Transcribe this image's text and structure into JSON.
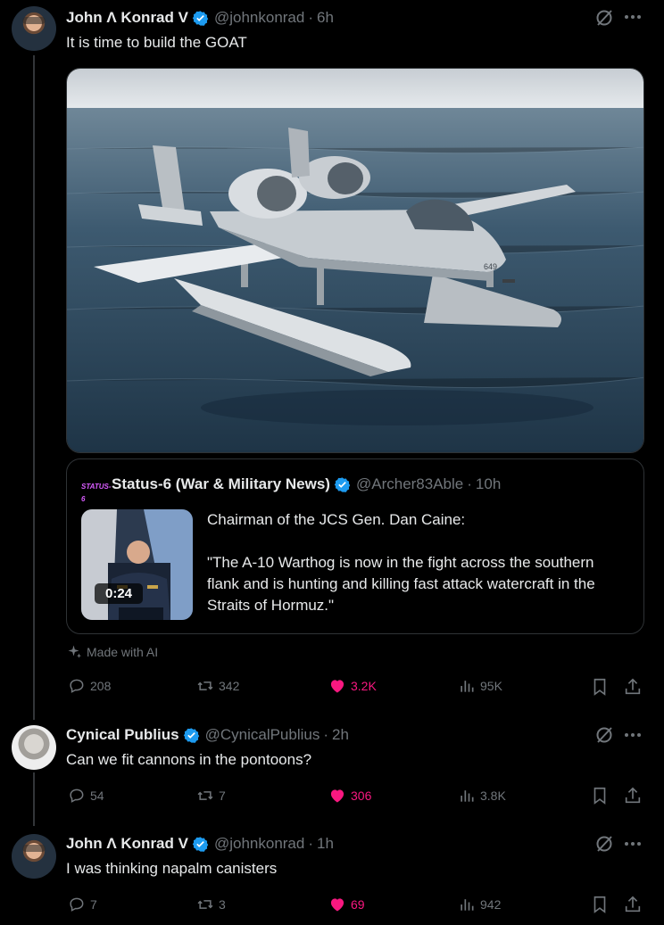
{
  "posts": [
    {
      "author": "John Λ Konrad V",
      "handle": "@johnkonrad",
      "time": "6h",
      "text": "It is time to build the GOAT",
      "media_alt": "A-10 Warthog aircraft fitted with pontoon floats on the ocean",
      "aircraft_number": "649",
      "quote": {
        "brand": "STATUS-6",
        "author": "Status-6 (War & Military News)",
        "handle": "@Archer83Able",
        "time": "10h",
        "duration": "0:24",
        "text_line1": "Chairman of the JCS Gen. Dan Caine:",
        "text_line2": "\"The A-10 Warthog is now in the fight across the southern flank and is hunting and killing fast attack watercraft in the Straits of Hormuz.\""
      },
      "made_with_ai": "Made with AI",
      "replies": "208",
      "reposts": "342",
      "likes": "3.2K",
      "views": "95K"
    },
    {
      "author": "Cynical Publius",
      "handle": "@CynicalPublius",
      "time": "2h",
      "text": "Can we fit cannons in the pontoons?",
      "replies": "54",
      "reposts": "7",
      "likes": "306",
      "views": "3.8K"
    },
    {
      "author": "John Λ Konrad V",
      "handle": "@johnkonrad",
      "time": "1h",
      "text": "I was thinking napalm canisters",
      "replies": "7",
      "reposts": "3",
      "likes": "69",
      "views": "942"
    }
  ],
  "colors": {
    "background": "#000000",
    "text": "#e7e9ea",
    "muted": "#71767b",
    "verified": "#1d9bf0",
    "like": "#f91880",
    "border": "#2f3336"
  },
  "icons": [
    "grok-icon",
    "more-icon",
    "reply-icon",
    "repost-icon",
    "like-icon",
    "views-icon",
    "bookmark-icon",
    "share-icon",
    "verified-icon",
    "sparkle-icon"
  ]
}
